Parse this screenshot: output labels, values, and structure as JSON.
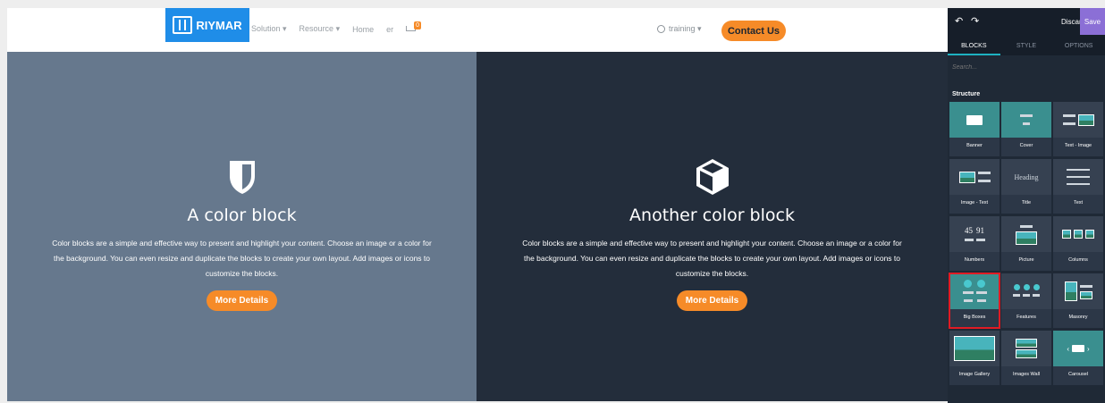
{
  "site": {
    "logo_text": "RIYMAR",
    "menu": [
      "Solution ▾",
      "Resource ▾",
      "Home",
      "er"
    ],
    "cart_count": "0",
    "user": "training ▾",
    "contact": "Contact Us"
  },
  "blocks": [
    {
      "title": "A color block",
      "text": "Color blocks are a simple and effective way to present and highlight your content. Choose an image or a color for the background. You can even resize and duplicate the blocks to create your own layout. Add images or icons to customize the blocks.",
      "button": "More Details",
      "background": "#66788d",
      "icon": "shield-icon"
    },
    {
      "title": "Another color block",
      "text": "Color blocks are a simple and effective way to present and highlight your content. Choose an image or a color for the background. You can even resize and duplicate the blocks to create your own layout. Add images or icons to customize the blocks.",
      "button": "More Details",
      "background": "#232d3b",
      "icon": "cube-icon"
    }
  ],
  "panel": {
    "undo": "↶",
    "redo": "↷",
    "discard": "Discard",
    "save": "Save",
    "tabs": [
      "BLOCKS",
      "STYLE",
      "OPTIONS"
    ],
    "search_placeholder": "Search...",
    "section": "Structure",
    "tiles": [
      "Banner",
      "Cover",
      "Text - Image",
      "Image - Text",
      "Title",
      "Text",
      "Numbers",
      "Picture",
      "Columns",
      "Big Boxes",
      "Features",
      "Masonry",
      "Image Gallery",
      "Images Wall",
      "Carousel"
    ],
    "title_preview": "Heading",
    "numbers_preview": [
      "45",
      "91"
    ],
    "highlighted": "Big Boxes"
  },
  "colors": {
    "accent": "#f68b28",
    "brand": "#1f8de8",
    "panel": "#1f2936",
    "save": "#8b6fd6"
  }
}
